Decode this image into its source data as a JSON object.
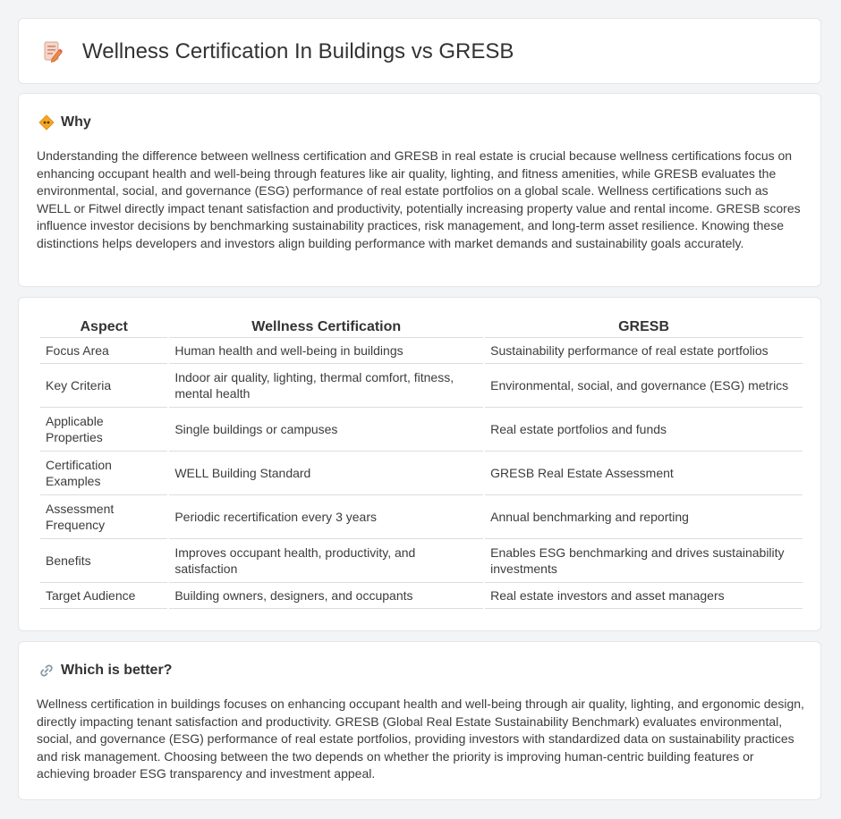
{
  "header": {
    "title": "Wellness Certification In Buildings vs GRESB",
    "icon": "document-pencil-icon"
  },
  "why": {
    "heading": "Why",
    "icon": "diamond-sign-icon",
    "body": "Understanding the difference between wellness certification and GRESB in real estate is crucial because wellness certifications focus on enhancing occupant health and well-being through features like air quality, lighting, and fitness amenities, while GRESB evaluates the environmental, social, and governance (ESG) performance of real estate portfolios on a global scale. Wellness certifications such as WELL or Fitwel directly impact tenant satisfaction and productivity, potentially increasing property value and rental income. GRESB scores influence investor decisions by benchmarking sustainability practices, risk management, and long-term asset resilience. Knowing these distinctions helps developers and investors align building performance with market demands and sustainability goals accurately."
  },
  "comparison": {
    "headers": [
      "Aspect",
      "Wellness Certification",
      "GRESB"
    ],
    "rows": [
      [
        "Focus Area",
        "Human health and well-being in buildings",
        "Sustainability performance of real estate portfolios"
      ],
      [
        "Key Criteria",
        "Indoor air quality, lighting, thermal comfort, fitness, mental health",
        "Environmental, social, and governance (ESG) metrics"
      ],
      [
        "Applicable Properties",
        "Single buildings or campuses",
        "Real estate portfolios and funds"
      ],
      [
        "Certification Examples",
        "WELL Building Standard",
        "GRESB Real Estate Assessment"
      ],
      [
        "Assessment Frequency",
        "Periodic recertification every 3 years",
        "Annual benchmarking and reporting"
      ],
      [
        "Benefits",
        "Improves occupant health, productivity, and satisfaction",
        "Enables ESG benchmarking and drives sustainability investments"
      ],
      [
        "Target Audience",
        "Building owners, designers, and occupants",
        "Real estate investors and asset managers"
      ]
    ]
  },
  "better": {
    "heading": "Which is better?",
    "icon": "link-icon",
    "body": "Wellness certification in buildings focuses on enhancing occupant health and well-being through air quality, lighting, and ergonomic design, directly impacting tenant satisfaction and productivity. GRESB (Global Real Estate Sustainability Benchmark) evaluates environmental, social, and governance (ESG) performance of real estate portfolios, providing investors with standardized data on sustainability practices and risk management. Choosing between the two depends on whether the priority is improving human-centric building features or achieving broader ESG transparency and investment appeal."
  }
}
